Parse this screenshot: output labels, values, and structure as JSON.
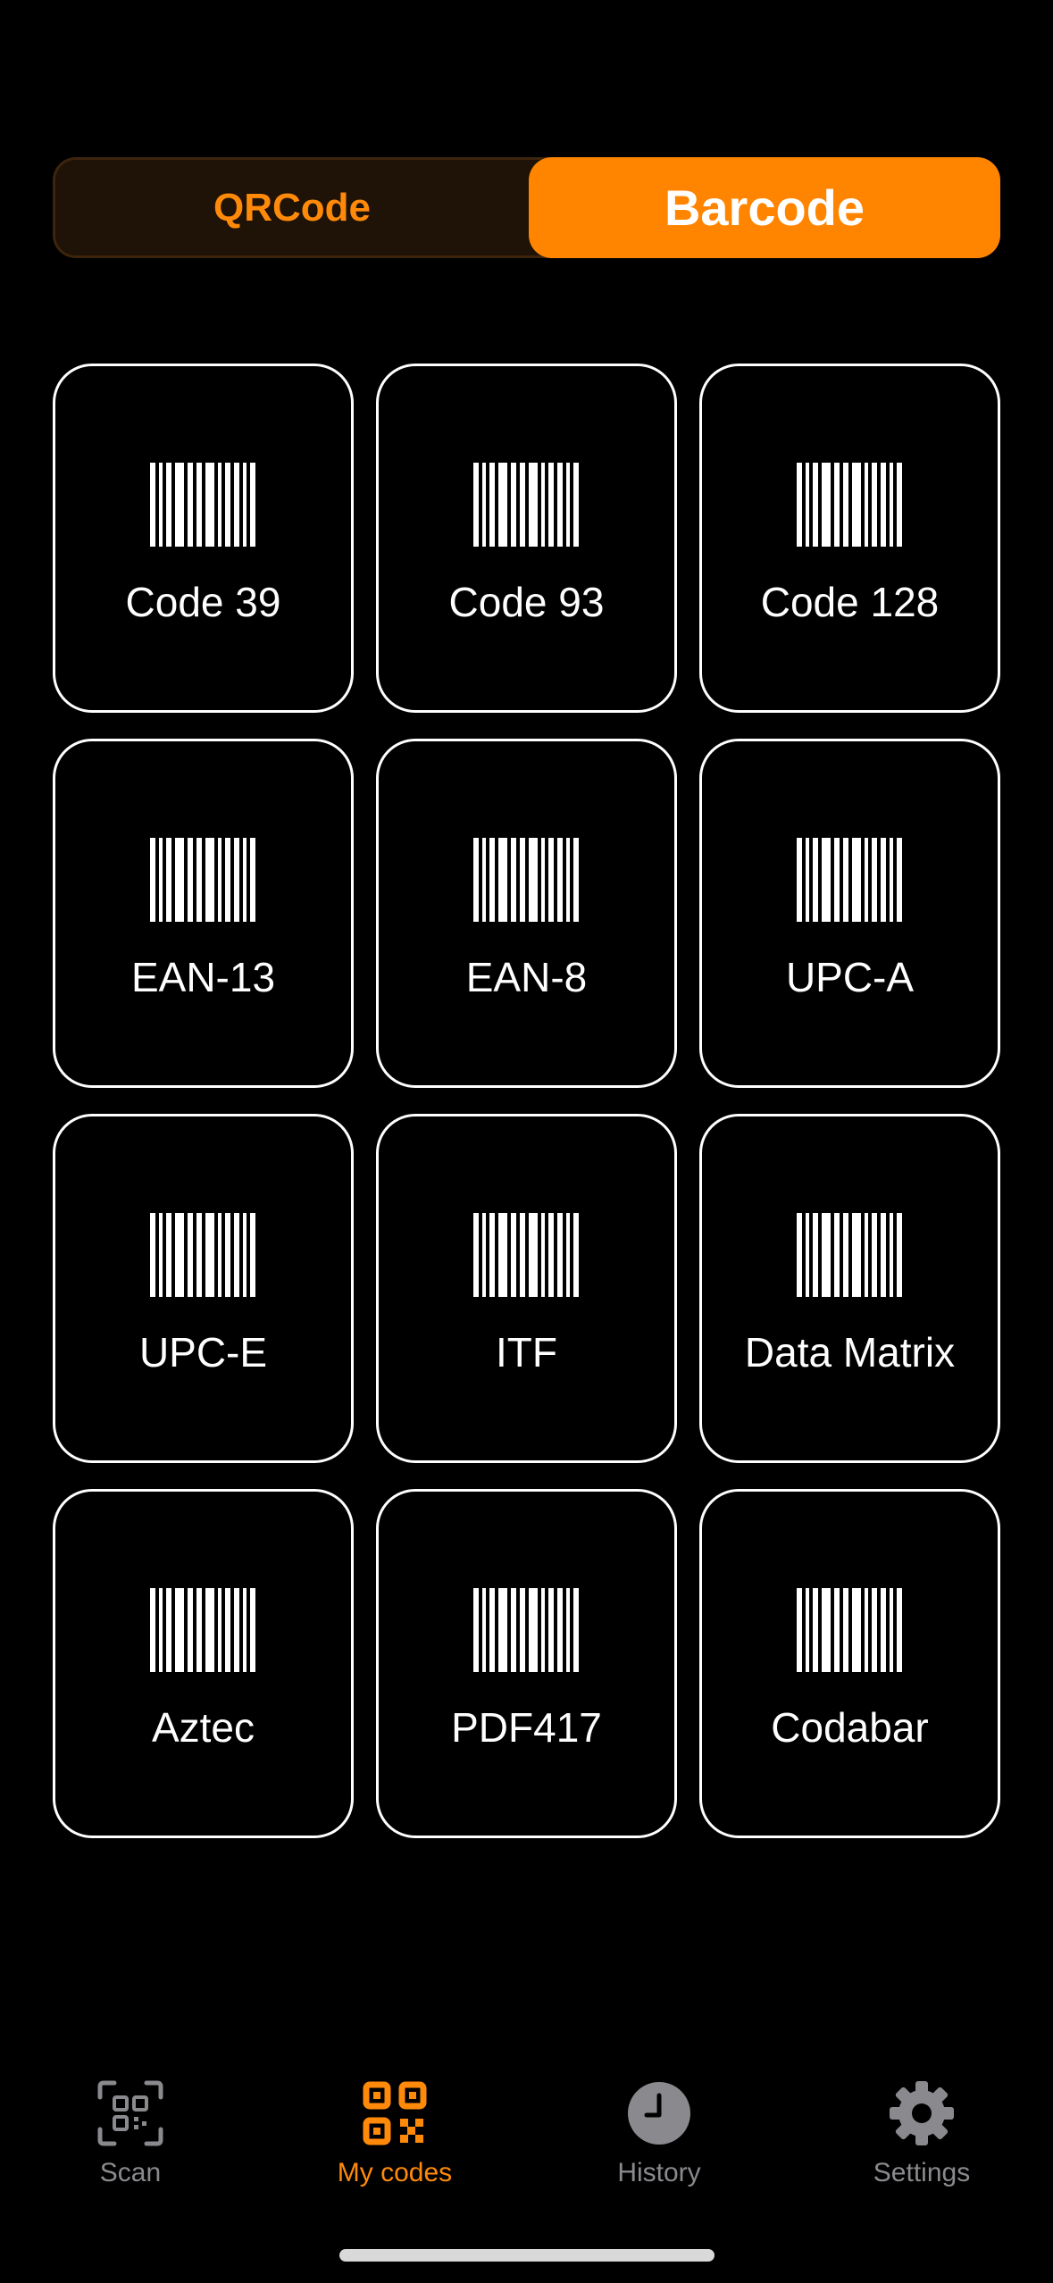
{
  "segmented": {
    "options": [
      "QRCode",
      "Barcode"
    ],
    "selected": "Barcode"
  },
  "barcode_types": [
    {
      "label": "Code 39",
      "icon": "barcode-icon"
    },
    {
      "label": "Code 93",
      "icon": "barcode-icon"
    },
    {
      "label": "Code 128",
      "icon": "barcode-icon"
    },
    {
      "label": "EAN-13",
      "icon": "barcode-icon"
    },
    {
      "label": "EAN-8",
      "icon": "barcode-icon"
    },
    {
      "label": "UPC-A",
      "icon": "barcode-icon"
    },
    {
      "label": "UPC-E",
      "icon": "barcode-icon"
    },
    {
      "label": "ITF",
      "icon": "barcode-icon"
    },
    {
      "label": "Data Matrix",
      "icon": "barcode-icon"
    },
    {
      "label": "Aztec",
      "icon": "barcode-icon"
    },
    {
      "label": "PDF417",
      "icon": "barcode-icon"
    },
    {
      "label": "Codabar",
      "icon": "barcode-icon"
    }
  ],
  "tabbar": {
    "tabs": [
      {
        "label": "Scan",
        "icon": "qr-scan-icon",
        "active": false
      },
      {
        "label": "My codes",
        "icon": "qr-code-icon",
        "active": true
      },
      {
        "label": "History",
        "icon": "clock-icon",
        "active": false
      },
      {
        "label": "Settings",
        "icon": "gear-icon",
        "active": false
      }
    ]
  },
  "colors": {
    "accent": "#ff8500",
    "background": "#000000",
    "inactive": "#8a8a8e"
  }
}
